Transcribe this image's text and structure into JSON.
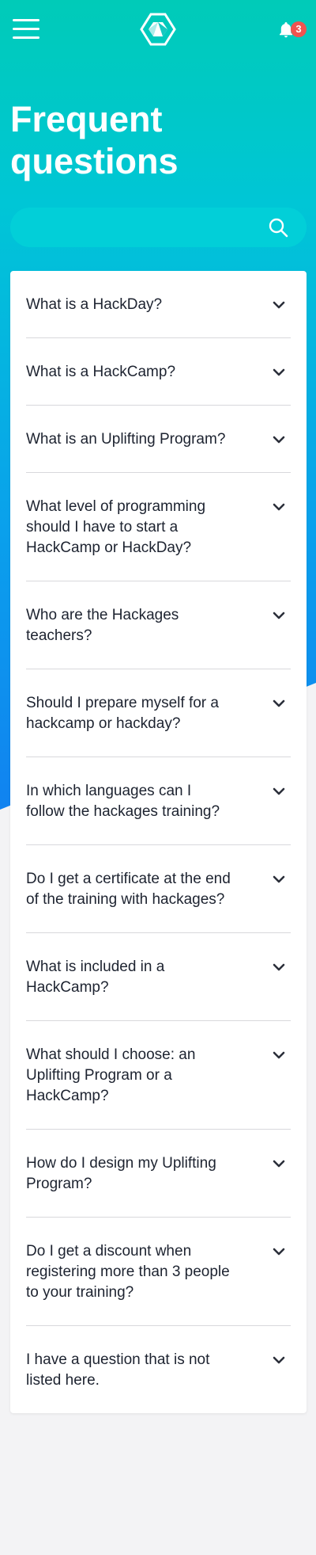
{
  "header": {
    "menu_icon": "hamburger-menu-icon",
    "logo_icon": "hackages-cube-logo",
    "bell_icon": "notification-bell-icon",
    "notification_count": "3"
  },
  "page": {
    "title": "Frequent questions"
  },
  "search": {
    "value": "",
    "placeholder": "",
    "icon": "search-icon"
  },
  "faq": {
    "chevron_icon": "chevron-down-icon",
    "items": [
      {
        "question": "What is a HackDay?"
      },
      {
        "question": "What is a HackCamp?"
      },
      {
        "question": "What is an Uplifting Program?"
      },
      {
        "question": "What level of programming should I have to start a HackCamp or HackDay?"
      },
      {
        "question": "Who are the Hackages teachers?"
      },
      {
        "question": "Should I prepare myself for a hackcamp or hackday?"
      },
      {
        "question": "In which languages can I follow the hackages training?"
      },
      {
        "question": "Do I get a certificate at the end of the training with hackages?"
      },
      {
        "question": "What is included in a HackCamp?"
      },
      {
        "question": "What should I choose: an Uplifting Program or a HackCamp?"
      },
      {
        "question": "How do I design my Uplifting Program?"
      },
      {
        "question": "Do I get a discount when registering more than 3 people to your training?"
      },
      {
        "question": "I have a question that is not listed here."
      }
    ]
  },
  "colors": {
    "gradient_top": "#00cbb8",
    "gradient_bottom": "#1182f0",
    "badge": "#ef5350",
    "text_dark": "#1d2330"
  }
}
